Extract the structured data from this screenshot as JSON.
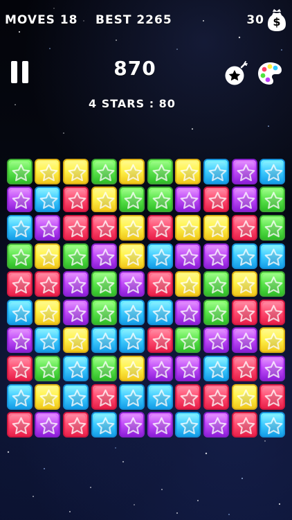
{
  "hud": {
    "moves_label": "MOVES 18",
    "best_label": "BEST 2265",
    "coins": "30",
    "score": "870",
    "target_label": "4 STARS : 80"
  },
  "icons": {
    "pause": "pause-icon",
    "money_bag": "money-bag-icon",
    "bomb": "bomb-icon",
    "palette": "palette-icon",
    "star": "star-icon"
  },
  "colors": {
    "background": "#05060b",
    "green": "#4fe33e",
    "yellow": "#fff23b",
    "purple": "#bb3df7",
    "blue": "#31c9ff",
    "red": "#ff3f66"
  },
  "board": {
    "rows": [
      [
        "green",
        "yellow",
        "yellow",
        "green",
        "yellow",
        "green",
        "yellow",
        "blue",
        "purple",
        "blue"
      ],
      [
        "purple",
        "blue",
        "red",
        "yellow",
        "green",
        "green",
        "purple",
        "red",
        "purple",
        "green"
      ],
      [
        "blue",
        "purple",
        "red",
        "red",
        "yellow",
        "red",
        "yellow",
        "yellow",
        "red",
        "green"
      ],
      [
        "green",
        "yellow",
        "green",
        "purple",
        "yellow",
        "blue",
        "purple",
        "purple",
        "blue",
        "blue"
      ],
      [
        "red",
        "red",
        "purple",
        "green",
        "purple",
        "red",
        "yellow",
        "green",
        "yellow",
        "green"
      ],
      [
        "blue",
        "yellow",
        "purple",
        "green",
        "blue",
        "blue",
        "purple",
        "green",
        "red",
        "red"
      ],
      [
        "purple",
        "blue",
        "yellow",
        "blue",
        "blue",
        "red",
        "green",
        "purple",
        "purple",
        "yellow"
      ],
      [
        "red",
        "green",
        "blue",
        "green",
        "yellow",
        "purple",
        "purple",
        "blue",
        "red",
        "purple"
      ],
      [
        "blue",
        "yellow",
        "blue",
        "red",
        "blue",
        "blue",
        "red",
        "red",
        "yellow",
        "red"
      ],
      [
        "red",
        "purple",
        "red",
        "blue",
        "purple",
        "purple",
        "blue",
        "purple",
        "red",
        "blue"
      ]
    ]
  }
}
